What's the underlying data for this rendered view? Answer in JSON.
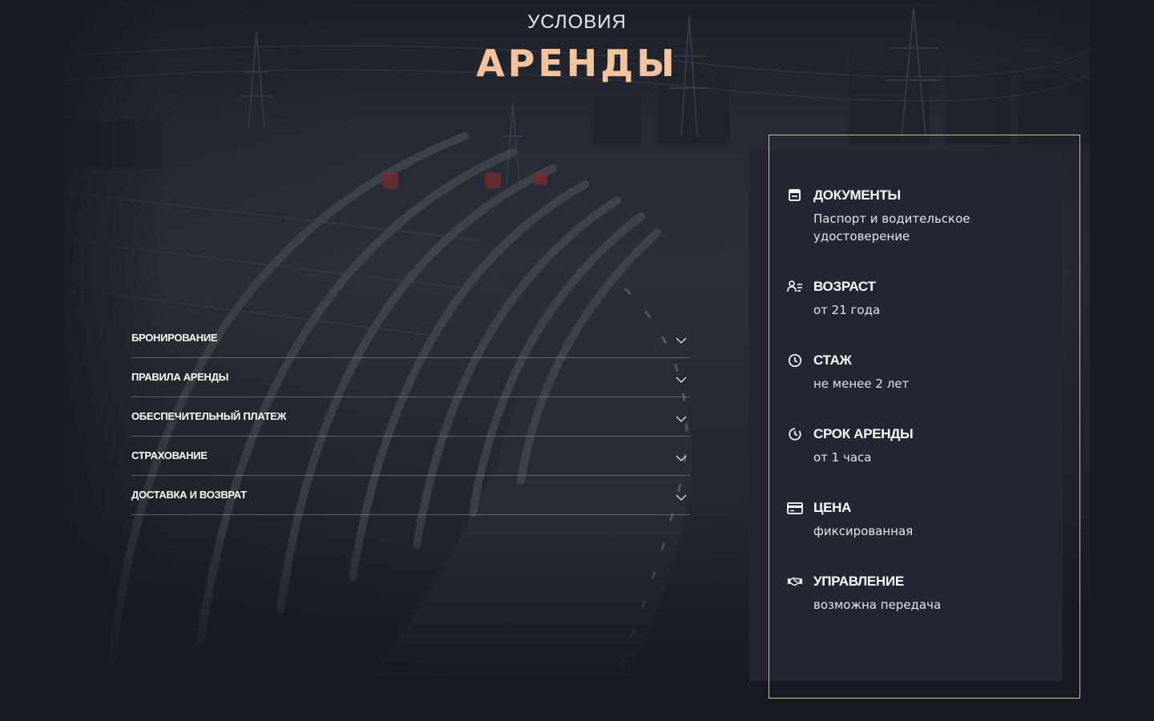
{
  "heading": {
    "top": "УСЛОВИЯ",
    "main": "АРЕНДЫ"
  },
  "colors": {
    "accent": "#f2c39d",
    "frame": "#e0b694",
    "panel": "#232734",
    "background": "#161a22"
  },
  "accordion": {
    "items": [
      {
        "label": "БРОНИРОВАНИЕ",
        "icon": "chevron-down-icon"
      },
      {
        "label": "ПРАВИЛА АРЕНДЫ",
        "icon": "chevron-down-icon"
      },
      {
        "label": "ОБЕСПЕЧИТЕЛЬНЫЙ ПЛАТЕЖ",
        "icon": "chevron-down-icon"
      },
      {
        "label": "СТРАХОВАНИЕ",
        "icon": "chevron-down-icon"
      },
      {
        "label": "ДОСТАВКА И ВОЗВРАТ",
        "icon": "chevron-down-icon"
      }
    ]
  },
  "info": {
    "items": [
      {
        "icon": "document-icon",
        "title": "ДОКУМЕНТЫ",
        "text": "Паспорт и водительское удостоверение"
      },
      {
        "icon": "person-icon",
        "title": "ВОЗРАСТ",
        "text": "от 21 года"
      },
      {
        "icon": "clock-icon",
        "title": "СТАЖ",
        "text": "не менее 2 лет"
      },
      {
        "icon": "timer-icon",
        "title": "СРОК АРЕНДЫ",
        "text": "от 1 часа"
      },
      {
        "icon": "card-icon",
        "title": "ЦЕНА",
        "text": "фиксированная"
      },
      {
        "icon": "handshake-icon",
        "title": "УПРАВЛЕНИЕ",
        "text": "возможна передача"
      }
    ]
  }
}
